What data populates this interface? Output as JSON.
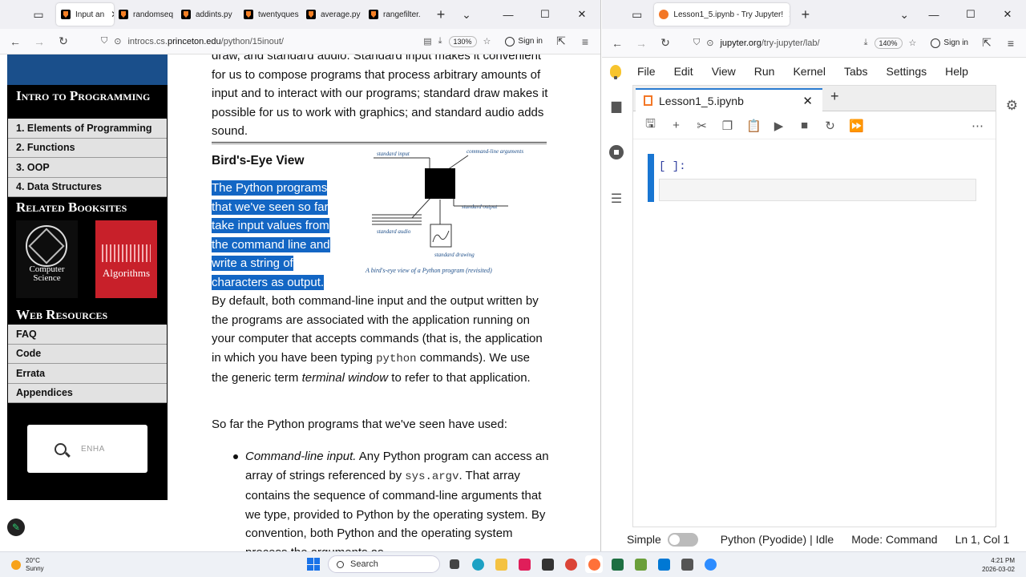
{
  "left_browser": {
    "tabs": [
      {
        "label": "Input an",
        "active": true
      },
      {
        "label": "randomseq",
        "active": false
      },
      {
        "label": "addints.py",
        "active": false
      },
      {
        "label": "twentyques",
        "active": false
      },
      {
        "label": "average.py",
        "active": false
      },
      {
        "label": "rangefilter.",
        "active": false
      }
    ],
    "url_prefix": "introcs.cs.",
    "url_domain": "princeton.edu",
    "url_path": "/python/15inout/",
    "zoom": "130%",
    "sign_in": "Sign in"
  },
  "sidebar": {
    "heading_intro": "Intro to Programming",
    "items_intro": [
      "1.  Elements of Programming",
      "2.  Functions",
      "3.  OOP",
      "4.  Data Structures"
    ],
    "heading_books": "Related Booksites",
    "book1_title": "Computer Science",
    "book2_title": "Algorithms",
    "heading_web": "Web Resources",
    "items_web": [
      "FAQ",
      "Code",
      "Errata",
      "Appendices"
    ],
    "search_placeholder": "ENHA"
  },
  "article": {
    "intro_fragment": "draw, and standard audio. Standard input makes it convenient for us to compose programs that process arbitrary amounts of input and to interact with our programs; standard draw makes it possible for us to work with graphics; and standard audio adds sound.",
    "section_title": "Bird's-Eye View",
    "highlighted": "The Python programs that we've seen so far take input values from the command line and write a string of characters as output.",
    "figure": {
      "label_input": "standard input",
      "label_cmd": "command-line arguments",
      "label_output": "standard output",
      "label_audio": "standard audio",
      "label_drawing": "standard drawing",
      "caption": "A bird's-eye view of a Python program (revisited)"
    },
    "para2_a": "By default, both command-line input and the output written by the programs are associated with the application running on your computer that accepts commands (that is, the application in which you have been typing ",
    "para2_code": "python",
    "para2_b": " commands). We use the generic term ",
    "para2_em": "terminal window",
    "para2_c": " to refer to that application.",
    "para3": "So far the Python programs that we've seen have used:",
    "bullet_em": "Command-line input.",
    "bullet_a": " Any Python program can access an array of strings referenced by ",
    "bullet_code": "sys.argv",
    "bullet_b": ". That array contains the sequence of command-line arguments that we type, provided to Python by the operating system. By convention, both Python and the operating system process the arguments as"
  },
  "right_browser": {
    "tab_label": "Lesson1_5.ipynb - Try Jupyter!",
    "url_domain": "jupyter.org",
    "url_path": "/try-jupyter/lab/",
    "zoom": "140%",
    "sign_in": "Sign in"
  },
  "jupyter": {
    "menu": [
      "File",
      "Edit",
      "View",
      "Run",
      "Kernel",
      "Tabs",
      "Settings",
      "Help"
    ],
    "notebook_tab": "Lesson1_5.ipynb",
    "cell_prompt": "[ ]:",
    "status_simple": "Simple",
    "status_kernel": "Python (Pyodide) | Idle",
    "status_mode": "Mode: Command",
    "status_pos": "Ln 1, Col 1"
  },
  "taskbar": {
    "temp": "20°C",
    "weather": "Sunny",
    "search": "Search",
    "time": "4:21 PM",
    "date": "2026-03-02"
  },
  "colors": {
    "highlight": "#1366c4",
    "sidebar_banner": "#1a4f8b",
    "jupyter_accent": "#1976d2"
  }
}
